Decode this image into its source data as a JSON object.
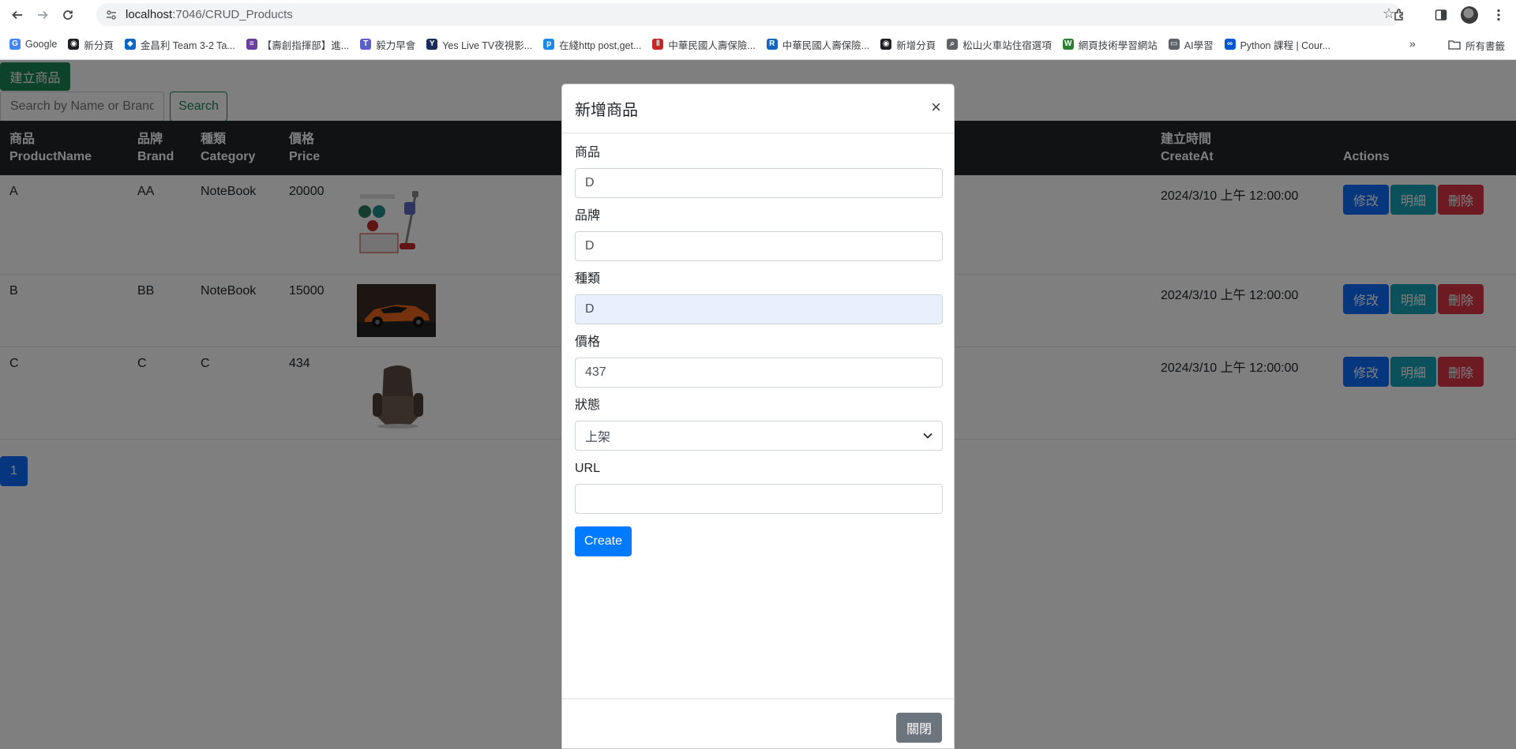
{
  "browser": {
    "url_host": "localhost",
    "url_path": ":7046/CRUD_Products",
    "bookmarks": [
      {
        "label": "Google",
        "color": "#4285f4",
        "glyph": "G"
      },
      {
        "label": "新分頁",
        "color": "#202124",
        "glyph": "◉"
      },
      {
        "label": "金昌利 Team 3-2 Ta...",
        "color": "#0a66c2",
        "glyph": "◆"
      },
      {
        "label": "【壽創指揮部】進...",
        "color": "#6b3fa0",
        "glyph": "≡"
      },
      {
        "label": "毅力早會",
        "color": "#5b5fc7",
        "glyph": "T"
      },
      {
        "label": "Yes Live TV夜視影...",
        "color": "#1d2a5c",
        "glyph": "Y"
      },
      {
        "label": "在綫http post,get...",
        "color": "#1e88e5",
        "glyph": "p"
      },
      {
        "label": "中華民國人壽保險...",
        "color": "#c62828",
        "glyph": "‖"
      },
      {
        "label": "中華民國人壽保險...",
        "color": "#1565c0",
        "glyph": "R"
      },
      {
        "label": "新增分頁",
        "color": "#202124",
        "glyph": "◉"
      },
      {
        "label": "松山火車站住宿選項",
        "color": "#5f6368",
        "glyph": "⌕"
      },
      {
        "label": "網頁技術學習網站",
        "color": "#2e7d32",
        "glyph": "W"
      },
      {
        "label": "AI學習",
        "color": "#5f6368",
        "glyph": "▭"
      },
      {
        "label": "Python 課程 | Cour...",
        "color": "#0056d2",
        "glyph": "∞"
      }
    ],
    "bookmarks_more": "»",
    "all_bookmarks": "所有書籤"
  },
  "page": {
    "create_product_label": "建立商品",
    "search_placeholder": "Search by Name or Brand",
    "search_label": "Search",
    "headers": {
      "product": [
        "商品",
        "ProductName"
      ],
      "brand": [
        "品牌",
        "Brand"
      ],
      "category": [
        "種類",
        "Category"
      ],
      "price": [
        "價格",
        "Price"
      ],
      "created": [
        "建立時間",
        "CreateAt"
      ],
      "actions": "Actions"
    },
    "rows": [
      {
        "name": "A",
        "brand": "AA",
        "category": "NoteBook",
        "price": "20000",
        "image": "vacuum",
        "created": "2024/3/10 上午 12:00:00"
      },
      {
        "name": "B",
        "brand": "BB",
        "category": "NoteBook",
        "price": "15000",
        "image": "car",
        "created": "2024/3/10 上午 12:00:00"
      },
      {
        "name": "C",
        "brand": "C",
        "category": "C",
        "price": "434",
        "image": "chair",
        "created": "2024/3/10 上午 12:00:00"
      }
    ],
    "row_actions": {
      "edit": "修改",
      "detail": "明細",
      "delete": "刪除"
    },
    "pagination": [
      "1"
    ]
  },
  "modal": {
    "title": "新增商品",
    "close_glyph": "×",
    "fields": {
      "product": {
        "label": "商品",
        "value": "D"
      },
      "brand": {
        "label": "品牌",
        "value": "D"
      },
      "category": {
        "label": "種類",
        "value": "D"
      },
      "price": {
        "label": "價格",
        "value": "437"
      },
      "status": {
        "label": "狀態",
        "value": "上架"
      },
      "url": {
        "label": "URL",
        "value": ""
      }
    },
    "submit_label": "Create",
    "footer_close_label": "關閉"
  }
}
